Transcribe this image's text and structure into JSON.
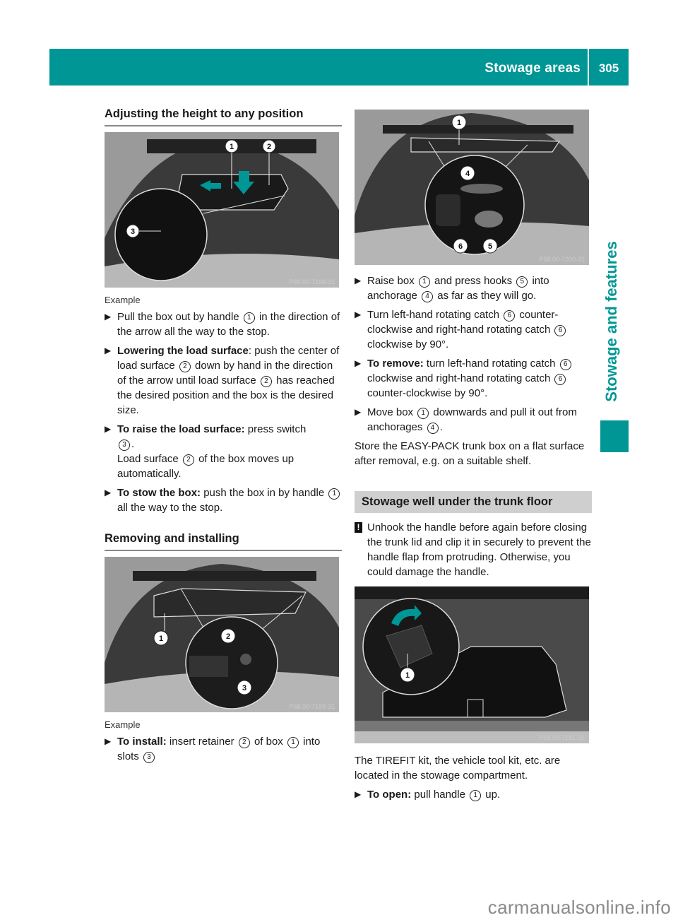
{
  "header": {
    "section": "Stowage areas",
    "page_number": "305"
  },
  "side_tab": {
    "label": "Stowage and features"
  },
  "colors": {
    "accent": "#009696",
    "subhead_bg": "#cfcfcf"
  },
  "left": {
    "heading1": "Adjusting the height to any position",
    "figure1": {
      "code": "P68.00-7198-31",
      "callouts": [
        "1",
        "2",
        "3"
      ]
    },
    "caption1": "Example",
    "steps1": [
      {
        "bold": "",
        "parts": [
          "Pull the box out by handle ",
          "1",
          " in the direction of the arrow all the way to the stop."
        ]
      },
      {
        "bold": "Lowering the load surface",
        "parts": [
          ": push the center of load surface ",
          "2",
          " down by hand in the direction of the arrow until load surface ",
          "2",
          " has reached the desired position and the box is the desired size."
        ]
      },
      {
        "bold": "To raise the load surface:",
        "parts": [
          " press switch ",
          "3",
          ".",
          "Load surface ",
          "2",
          " of the box moves up automatically."
        ]
      },
      {
        "bold": "To stow the box:",
        "parts": [
          " push the box in by handle ",
          "1",
          " all the way to the stop."
        ]
      }
    ],
    "heading2": "Removing and installing",
    "figure2": {
      "code": "P68.00-7199-31",
      "callouts": [
        "1",
        "2",
        "3"
      ]
    },
    "caption2": "Example",
    "steps2": [
      {
        "bold": "To install:",
        "parts": [
          " insert retainer ",
          "2",
          " of box ",
          "1",
          " into slots ",
          "3"
        ]
      }
    ]
  },
  "right": {
    "figure3": {
      "code": "P68.00-7200-31",
      "callouts": [
        "1",
        "4",
        "5",
        "6"
      ]
    },
    "steps": [
      {
        "bold": "",
        "parts": [
          "Raise box ",
          "1",
          " and press hooks ",
          "5",
          " into anchorage ",
          "4",
          " as far as they will go."
        ]
      },
      {
        "bold": "",
        "parts": [
          "Turn left-hand rotating catch ",
          "6",
          " counter-clockwise and right-hand rotating catch ",
          "6",
          " clockwise by 90°."
        ]
      },
      {
        "bold": "To remove:",
        "parts": [
          " turn left-hand rotating catch ",
          "6",
          " clockwise and right-hand rotating catch ",
          "6",
          " counter-clockwise by 90°."
        ]
      },
      {
        "bold": "",
        "parts": [
          "Move box ",
          "1",
          " downwards and pull it out from anchorages ",
          "4",
          "."
        ]
      }
    ],
    "store_note": "Store the EASY-PACK trunk box on a flat surface after removal, e.g. on a suitable shelf.",
    "heading3": "Stowage well under the trunk floor",
    "warning": "Unhook the handle before again before closing the trunk lid and clip it in securely to prevent the handle flap from protruding. Otherwise, you could damage the handle.",
    "figure4": {
      "code": "P68.00-7181-31",
      "callouts": [
        "1"
      ]
    },
    "kit_note": "The TIREFIT kit, the vehicle tool kit, etc. are located in the stowage compartment.",
    "open_step": {
      "bold": "To open:",
      "parts": [
        " pull handle ",
        "1",
        " up."
      ]
    }
  },
  "watermark": "carmanualsonline.info"
}
